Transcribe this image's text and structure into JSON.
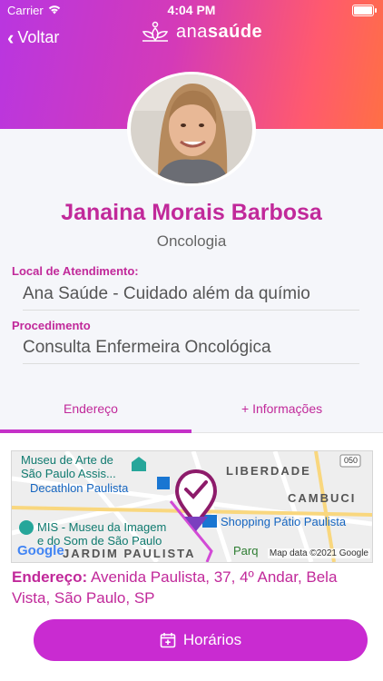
{
  "status_bar": {
    "carrier": "Carrier",
    "time": "4:04 PM"
  },
  "nav": {
    "back_label": "Voltar",
    "logo_light": "ana",
    "logo_bold": "saúde"
  },
  "profile": {
    "name": "Janaina Morais Barbosa",
    "specialty": "Oncologia"
  },
  "details": {
    "location_label": "Local de Atendimento:",
    "location_value": "Ana Saúde - Cuidado além da químio",
    "procedure_label": "Procedimento",
    "procedure_value": "Consulta Enfermeira Oncológica"
  },
  "tabs": [
    {
      "label": "Endereço",
      "active": true
    },
    {
      "label": "+ Informações",
      "active": false
    }
  ],
  "map": {
    "labels": {
      "museu_line1": "Museu de Arte de",
      "museu_line2": "São Paulo Assis...",
      "decathlon": "Decathlon Paulista",
      "mis_line1": "MIS - Museu da Imagem",
      "mis_line2": "e do Som de São Paulo",
      "jardim": "JARDIM PAULISTA",
      "liberdade": "LIBERDADE",
      "cambuci": "CAMBUCI",
      "shopping": "Shopping Pátio Paulista",
      "parque": "Parq",
      "road_shield": "050",
      "attribution": "Map data ©2021 Google",
      "google": "Google"
    }
  },
  "address": {
    "label": "Endereço:",
    "value": "Avenida Paulista, 37, 4º Andar, Bela Vista, São Paulo, SP"
  },
  "cta": {
    "label": "Horários"
  },
  "colors": {
    "accent": "#c1299a",
    "button": "#c92bd1",
    "gradient_start": "#b936e0",
    "gradient_end": "#ff6f45"
  }
}
